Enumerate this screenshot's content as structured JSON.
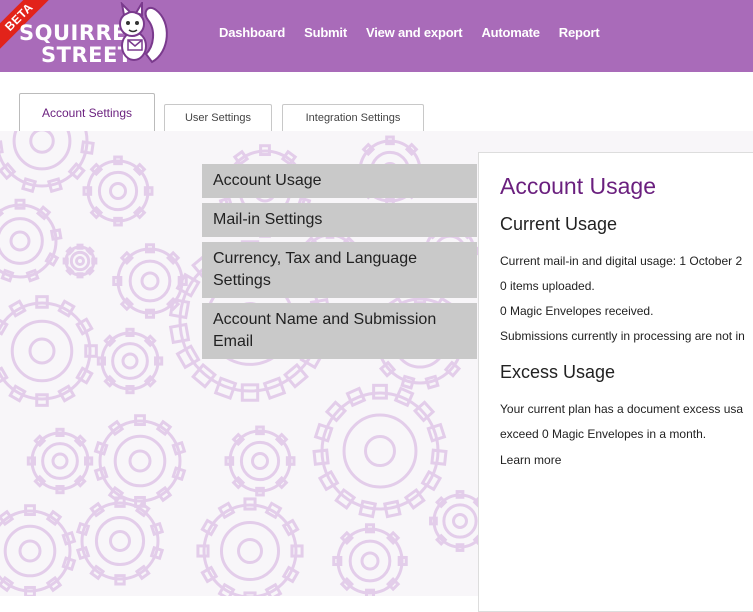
{
  "brand": {
    "line1": "SQUIRREL",
    "line2": "STREET",
    "beta": "BETA",
    "color": "#a96bb9"
  },
  "nav": {
    "items": [
      "Dashboard",
      "Submit",
      "View and export",
      "Automate",
      "Report"
    ]
  },
  "tabs": [
    "Account Settings",
    "User Settings",
    "Integration Settings"
  ],
  "menu": {
    "items": [
      "Account Usage",
      "Mail-in Settings",
      "Currency, Tax and Language Settings",
      "Account Name and Submission Email"
    ]
  },
  "panel": {
    "title": "Account Usage",
    "current_heading": "Current Usage",
    "current_line": "Current mail-in and digital usage: 1 October 2",
    "items_uploaded": "0 items uploaded.",
    "envelopes": "0 Magic Envelopes received.",
    "processing_note": "Submissions currently in processing are not in",
    "excess_heading": "Excess Usage",
    "excess_line1": "Your current plan has a document excess usa",
    "excess_line2": "exceed 0 Magic Envelopes in a month.",
    "learn_more": "Learn more"
  },
  "colors": {
    "accent": "#6a1f7e",
    "menu_bg": "#c9c9c9",
    "gear": "#e3cdea"
  }
}
